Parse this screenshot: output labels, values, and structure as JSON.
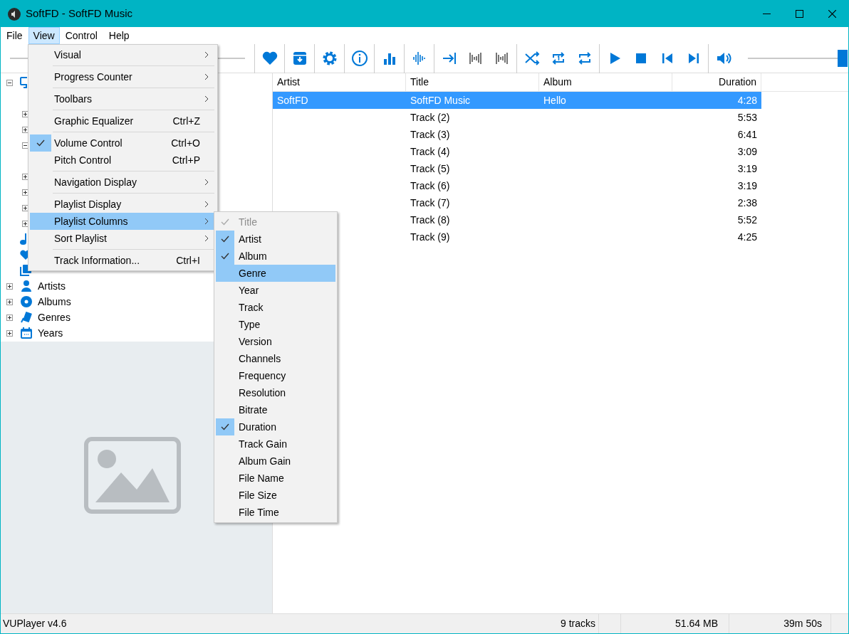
{
  "window": {
    "title": "SoftFD - SoftFD Music"
  },
  "menu_bar": [
    {
      "label": "File",
      "selected": false
    },
    {
      "label": "View",
      "selected": true
    },
    {
      "label": "Control",
      "selected": false
    },
    {
      "label": "Help",
      "selected": false
    }
  ],
  "volume": {
    "level": 1
  },
  "tree": [
    {
      "kind": "node",
      "expanded": true,
      "children": [
        {
          "kind": "leaf"
        },
        {
          "kind": "node",
          "expanded": false
        },
        {
          "kind": "node",
          "expanded": false
        },
        {
          "kind": "node",
          "expanded": true,
          "children": [
            {
              "kind": "leaf"
            }
          ]
        },
        {
          "kind": "node",
          "expanded": false
        },
        {
          "kind": "node",
          "expanded": false
        },
        {
          "kind": "node",
          "expanded": false
        },
        {
          "kind": "node",
          "expanded": false
        }
      ]
    },
    {
      "kind": "leaf"
    },
    {
      "kind": "leaf"
    },
    {
      "kind": "leaf"
    },
    {
      "kind": "node",
      "label": "Artists",
      "expanded": false
    },
    {
      "kind": "node",
      "label": "Albums",
      "expanded": false
    },
    {
      "kind": "node",
      "label": "Genres",
      "expanded": false
    },
    {
      "kind": "node",
      "label": "Years",
      "expanded": false
    }
  ],
  "playlist": {
    "columns": [
      "Artist",
      "Title",
      "Album",
      "Duration"
    ],
    "rows": [
      {
        "selected": true,
        "cells": [
          "SoftFD",
          "SoftFD Music",
          "Hello",
          "4:28"
        ]
      },
      {
        "selected": false,
        "cells": [
          "",
          "Track (2)",
          "",
          "5:53"
        ]
      },
      {
        "selected": false,
        "cells": [
          "",
          "Track (3)",
          "",
          "6:41"
        ]
      },
      {
        "selected": false,
        "cells": [
          "",
          "Track (4)",
          "",
          "3:09"
        ]
      },
      {
        "selected": false,
        "cells": [
          "",
          "Track (5)",
          "",
          "3:19"
        ]
      },
      {
        "selected": false,
        "cells": [
          "",
          "Track (6)",
          "",
          "3:19"
        ]
      },
      {
        "selected": false,
        "cells": [
          "",
          "Track (7)",
          "",
          "2:38"
        ]
      },
      {
        "selected": false,
        "cells": [
          "",
          "Track (8)",
          "",
          "5:52"
        ]
      },
      {
        "selected": false,
        "cells": [
          "",
          "Track (9)",
          "",
          "4:25"
        ]
      }
    ]
  },
  "view_menu": [
    {
      "kind": "item",
      "label": "Visual",
      "submenu": true,
      "checked": false,
      "selected": false
    },
    {
      "kind": "separator"
    },
    {
      "kind": "item",
      "label": "Progress Counter",
      "submenu": true,
      "checked": false,
      "selected": false
    },
    {
      "kind": "separator"
    },
    {
      "kind": "item",
      "label": "Toolbars",
      "submenu": true,
      "checked": false,
      "selected": false
    },
    {
      "kind": "separator"
    },
    {
      "kind": "item",
      "label": "Graphic Equalizer",
      "shortcut": "Ctrl+Z",
      "checked": false,
      "selected": false
    },
    {
      "kind": "separator"
    },
    {
      "kind": "item",
      "label": "Volume Control",
      "shortcut": "Ctrl+O",
      "checked": true,
      "selected": false
    },
    {
      "kind": "item",
      "label": "Pitch Control",
      "shortcut": "Ctrl+P",
      "checked": false,
      "selected": false
    },
    {
      "kind": "separator"
    },
    {
      "kind": "item",
      "label": "Navigation Display",
      "submenu": true,
      "checked": false,
      "selected": false
    },
    {
      "kind": "separator"
    },
    {
      "kind": "item",
      "label": "Playlist Display",
      "submenu": true,
      "checked": false,
      "selected": false
    },
    {
      "kind": "item",
      "label": "Playlist Columns",
      "submenu": true,
      "checked": false,
      "selected": true
    },
    {
      "kind": "item",
      "label": "Sort Playlist",
      "submenu": true,
      "checked": false,
      "selected": false
    },
    {
      "kind": "separator"
    },
    {
      "kind": "item",
      "label": "Track Information...",
      "shortcut": "Ctrl+I",
      "checked": false,
      "selected": false
    }
  ],
  "columns_submenu": [
    {
      "label": "Title",
      "checked": true,
      "disabled": true,
      "selected": false
    },
    {
      "label": "Artist",
      "checked": true,
      "disabled": false,
      "selected": false
    },
    {
      "label": "Album",
      "checked": true,
      "disabled": false,
      "selected": false
    },
    {
      "label": "Genre",
      "checked": false,
      "disabled": false,
      "selected": true
    },
    {
      "label": "Year",
      "checked": false,
      "disabled": false,
      "selected": false
    },
    {
      "label": "Track",
      "checked": false,
      "disabled": false,
      "selected": false
    },
    {
      "label": "Type",
      "checked": false,
      "disabled": false,
      "selected": false
    },
    {
      "label": "Version",
      "checked": false,
      "disabled": false,
      "selected": false
    },
    {
      "label": "Channels",
      "checked": false,
      "disabled": false,
      "selected": false
    },
    {
      "label": "Frequency",
      "checked": false,
      "disabled": false,
      "selected": false
    },
    {
      "label": "Resolution",
      "checked": false,
      "disabled": false,
      "selected": false
    },
    {
      "label": "Bitrate",
      "checked": false,
      "disabled": false,
      "selected": false
    },
    {
      "label": "Duration",
      "checked": true,
      "disabled": false,
      "selected": false
    },
    {
      "label": "Track Gain",
      "checked": false,
      "disabled": false,
      "selected": false
    },
    {
      "label": "Album Gain",
      "checked": false,
      "disabled": false,
      "selected": false
    },
    {
      "label": "File Name",
      "checked": false,
      "disabled": false,
      "selected": false
    },
    {
      "label": "File Size",
      "checked": false,
      "disabled": false,
      "selected": false
    },
    {
      "label": "File Time",
      "checked": false,
      "disabled": false,
      "selected": false
    }
  ],
  "status_bar": {
    "version": "VUPlayer v4.6",
    "tracks": "9 tracks",
    "size": "51.64 MB",
    "duration": "39m 50s"
  }
}
